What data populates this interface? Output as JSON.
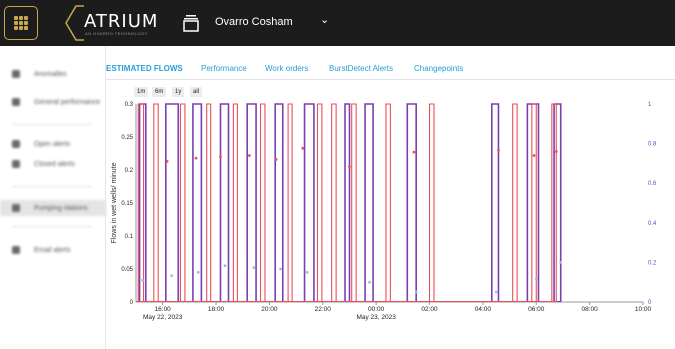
{
  "header": {
    "logo_text": "ATRIUM",
    "logo_tagline": "AN OVARRO TECHNOLOGY",
    "site_name": "Ovarro Cosham",
    "site_caret": "⌄"
  },
  "sidebar": {
    "items": [
      {
        "label": "Anomalies",
        "icon": "alert-icon"
      },
      {
        "label": "General performance",
        "icon": "chart-icon"
      },
      {
        "label": "Open alerts",
        "icon": "bell-icon"
      },
      {
        "label": "Closed alerts",
        "icon": "check-icon"
      },
      {
        "label": "Pumping stations",
        "icon": "pump-icon"
      },
      {
        "label": "Email alerts",
        "icon": "mail-icon"
      }
    ]
  },
  "tabs": [
    {
      "label": "ESTIMATED FLOWS",
      "active": true
    },
    {
      "label": "Performance",
      "active": false
    },
    {
      "label": "Work orders",
      "active": false
    },
    {
      "label": "BurstDetect Alerts",
      "active": false
    },
    {
      "label": "Changepoints",
      "active": false
    }
  ],
  "range_buttons": [
    "1m",
    "6m",
    "1y",
    "all"
  ],
  "colors": {
    "accent": "#2a9ed6",
    "red_series": "#e8505b",
    "purple_series": "#7a3fb0",
    "gold": "#c8a84a"
  },
  "chart_data": {
    "type": "line",
    "ylabel": "Flows in wet wells/ minute",
    "ylim": [
      0,
      0.3
    ],
    "y_ticks": [
      "0",
      "0.05",
      "0.1",
      "0.15",
      "0.2",
      "0.25",
      "0.3"
    ],
    "y2lim": [
      0,
      1
    ],
    "y2_ticks": [
      "0",
      "0.2",
      "0.4",
      "0.6",
      "0.8",
      "1"
    ],
    "x_range": [
      "2023-05-22 15:00",
      "2023-05-23 10:00"
    ],
    "x_ticks": [
      {
        "time": "2023-05-22 16:00",
        "label": "16:00",
        "sub": "May 22, 2023"
      },
      {
        "time": "2023-05-22 18:00",
        "label": "18:00",
        "sub": ""
      },
      {
        "time": "2023-05-22 20:00",
        "label": "20:00",
        "sub": ""
      },
      {
        "time": "2023-05-22 22:00",
        "label": "22:00",
        "sub": ""
      },
      {
        "time": "2023-05-23 00:00",
        "label": "00:00",
        "sub": "May 23, 2023"
      },
      {
        "time": "2023-05-23 02:00",
        "label": "02:00",
        "sub": ""
      },
      {
        "time": "2023-05-23 04:00",
        "label": "04:00",
        "sub": ""
      },
      {
        "time": "2023-05-23 06:00",
        "label": "06:00",
        "sub": ""
      },
      {
        "time": "2023-05-23 08:00",
        "label": "08:00",
        "sub": ""
      },
      {
        "time": "2023-05-23 10:00",
        "label": "10:00",
        "sub": ""
      }
    ],
    "series": [
      {
        "color": "#7a3fb0",
        "axis": "right",
        "pulses": [
          [
            "2023-05-22 15:08",
            "2023-05-22 15:22"
          ],
          [
            "2023-05-22 16:07",
            "2023-05-22 16:35"
          ],
          [
            "2023-05-22 17:08",
            "2023-05-22 17:27"
          ],
          [
            "2023-05-22 18:10",
            "2023-05-22 18:28"
          ],
          [
            "2023-05-22 19:10",
            "2023-05-22 19:30"
          ],
          [
            "2023-05-22 20:13",
            "2023-05-22 20:30"
          ],
          [
            "2023-05-22 21:19",
            "2023-05-22 21:40"
          ],
          [
            "2023-05-22 22:50",
            "2023-05-22 23:00"
          ],
          [
            "2023-05-22 23:35",
            "2023-05-22 23:53"
          ],
          [
            "2023-05-23 01:10",
            "2023-05-23 01:30"
          ],
          [
            "2023-05-23 04:20",
            "2023-05-23 04:35"
          ],
          [
            "2023-05-23 05:40",
            "2023-05-23 06:05"
          ],
          [
            "2023-05-23 06:40",
            "2023-05-23 06:55"
          ]
        ]
      },
      {
        "color": "#e8505b",
        "axis": "right",
        "pulses": [
          [
            "2023-05-22 15:05",
            "2023-05-22 15:17"
          ],
          [
            "2023-05-22 15:40",
            "2023-05-22 15:50"
          ],
          [
            "2023-05-22 16:40",
            "2023-05-22 16:50"
          ],
          [
            "2023-05-22 17:39",
            "2023-05-22 17:48"
          ],
          [
            "2023-05-22 18:39",
            "2023-05-22 18:48"
          ],
          [
            "2023-05-22 19:40",
            "2023-05-22 19:50"
          ],
          [
            "2023-05-22 20:42",
            "2023-05-22 20:51"
          ],
          [
            "2023-05-22 21:48",
            "2023-05-22 21:58"
          ],
          [
            "2023-05-22 22:20",
            "2023-05-22 22:30"
          ],
          [
            "2023-05-22 23:05",
            "2023-05-22 23:15"
          ],
          [
            "2023-05-23 00:22",
            "2023-05-23 00:32"
          ],
          [
            "2023-05-23 02:00",
            "2023-05-23 02:10"
          ],
          [
            "2023-05-23 05:07",
            "2023-05-23 05:17"
          ],
          [
            "2023-05-23 05:50",
            "2023-05-23 06:00"
          ],
          [
            "2023-05-23 06:35",
            "2023-05-23 06:45"
          ]
        ]
      },
      {
        "color": "#e8505b",
        "axis": "left",
        "points": [
          [
            "2023-05-22 16:10",
            0.213
          ],
          [
            "2023-05-22 17:15",
            0.218
          ],
          [
            "2023-05-22 18:10",
            0.22
          ],
          [
            "2023-05-22 19:15",
            0.222
          ],
          [
            "2023-05-22 20:15",
            0.216
          ],
          [
            "2023-05-22 21:15",
            0.233
          ],
          [
            "2023-05-22 23:00",
            0.205
          ],
          [
            "2023-05-23 01:25",
            0.227
          ],
          [
            "2023-05-23 04:35",
            0.23
          ],
          [
            "2023-05-23 05:55",
            0.222
          ],
          [
            "2023-05-23 06:45",
            0.228
          ]
        ]
      },
      {
        "color": "#8fc3e6",
        "axis": "left",
        "points": [
          [
            "2023-05-22 15:15",
            0.033
          ],
          [
            "2023-05-22 16:20",
            0.04
          ],
          [
            "2023-05-22 17:20",
            0.045
          ],
          [
            "2023-05-22 18:20",
            0.055
          ],
          [
            "2023-05-22 19:25",
            0.052
          ],
          [
            "2023-05-22 20:25",
            0.05
          ],
          [
            "2023-05-22 21:25",
            0.045
          ],
          [
            "2023-05-22 23:45",
            0.03
          ],
          [
            "2023-05-23 01:30",
            0.015
          ],
          [
            "2023-05-23 04:30",
            0.015
          ],
          [
            "2023-05-23 06:00",
            0.035
          ],
          [
            "2023-05-23 06:55",
            0.06
          ]
        ]
      }
    ]
  }
}
